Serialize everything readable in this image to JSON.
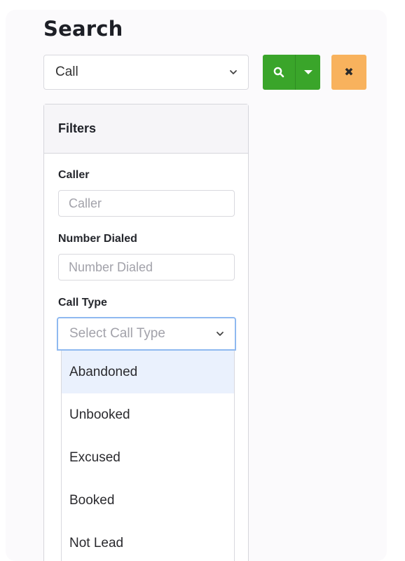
{
  "search": {
    "title": "Search",
    "type_select": {
      "value": "Call"
    },
    "search_button": {
      "icon": "search-icon"
    },
    "dropdown_toggle": {
      "icon": "caret-down-icon"
    },
    "clear_button": {
      "icon": "close-icon",
      "glyph": "✖"
    }
  },
  "colors": {
    "search_green": "#3aa52a",
    "clear_orange": "#f8b25d",
    "focus_blue": "#8fb9f0",
    "highlight": "#eaf1fd"
  },
  "filters": {
    "title": "Filters",
    "caller": {
      "label": "Caller",
      "placeholder": "Caller",
      "value": ""
    },
    "number_dialed": {
      "label": "Number Dialed",
      "placeholder": "Number Dialed",
      "value": ""
    },
    "call_type": {
      "label": "Call Type",
      "placeholder": "Select Call Type",
      "open": true,
      "highlighted_index": 0,
      "options": [
        "Abandoned",
        "Unbooked",
        "Excused",
        "Booked",
        "Not Lead"
      ]
    }
  }
}
